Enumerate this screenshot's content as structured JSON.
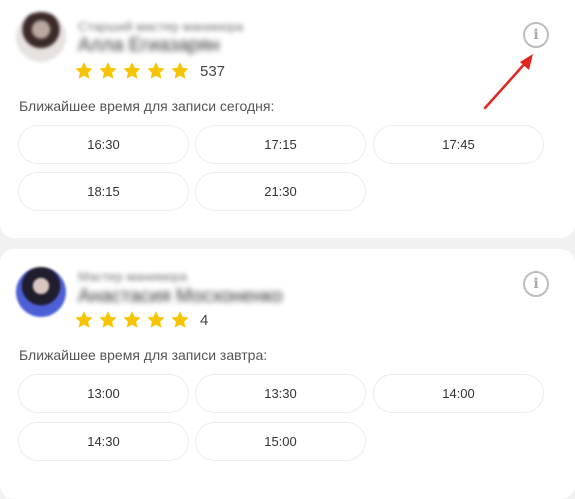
{
  "specialists": [
    {
      "role": "Старший мастер маникюра",
      "name": "Алла Егиазарян",
      "rating_count": "537",
      "slots_title": "Ближайшее время для записи сегодня:",
      "slots": [
        "16:30",
        "17:15",
        "17:45",
        "18:15",
        "21:30"
      ]
    },
    {
      "role": "Мастер маникюра",
      "name": "Анастасия Мосхоненко",
      "rating_count": "4",
      "slots_title": "Ближайшее время для записи завтра:",
      "slots": [
        "13:00",
        "13:30",
        "14:00",
        "14:30",
        "15:00"
      ]
    }
  ],
  "info_icon_glyph": "i",
  "colors": {
    "star": "#f6c400",
    "annotation_arrow": "#e3261f",
    "info_icon": "#bdbdbd"
  }
}
